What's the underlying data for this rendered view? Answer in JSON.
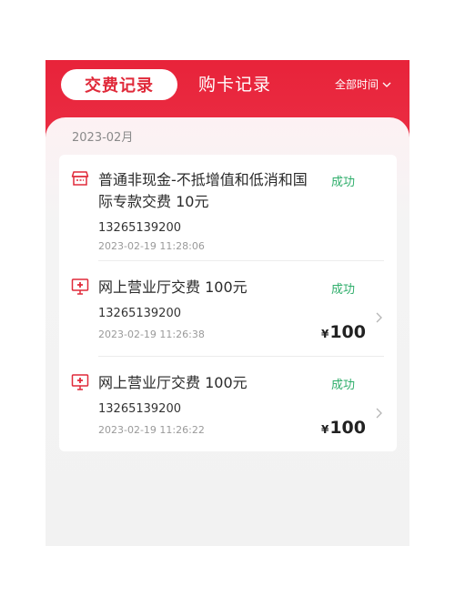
{
  "tabs": {
    "active": "交费记录",
    "inactive": "购卡记录"
  },
  "filter": {
    "label": "全部时间"
  },
  "month": "2023-02月",
  "records": [
    {
      "title": "普通非现金-不抵增值和低消和国际专款交费 10元",
      "status": "成功",
      "phone": "13265139200",
      "time": "2023-02-19 11:28:06",
      "amount": "",
      "icon": "shop-icon"
    },
    {
      "title": "网上营业厅交费 100元",
      "status": "成功",
      "phone": "13265139200",
      "time": "2023-02-19 11:26:38",
      "currency": "¥",
      "amount": "100",
      "icon": "monitor-cross-icon"
    },
    {
      "title": "网上营业厅交费 100元",
      "status": "成功",
      "phone": "13265139200",
      "time": "2023-02-19 11:26:22",
      "currency": "¥",
      "amount": "100",
      "icon": "monitor-cross-icon"
    }
  ],
  "colors": {
    "brand_red": "#e8233a",
    "success_green": "#2fae6b"
  }
}
